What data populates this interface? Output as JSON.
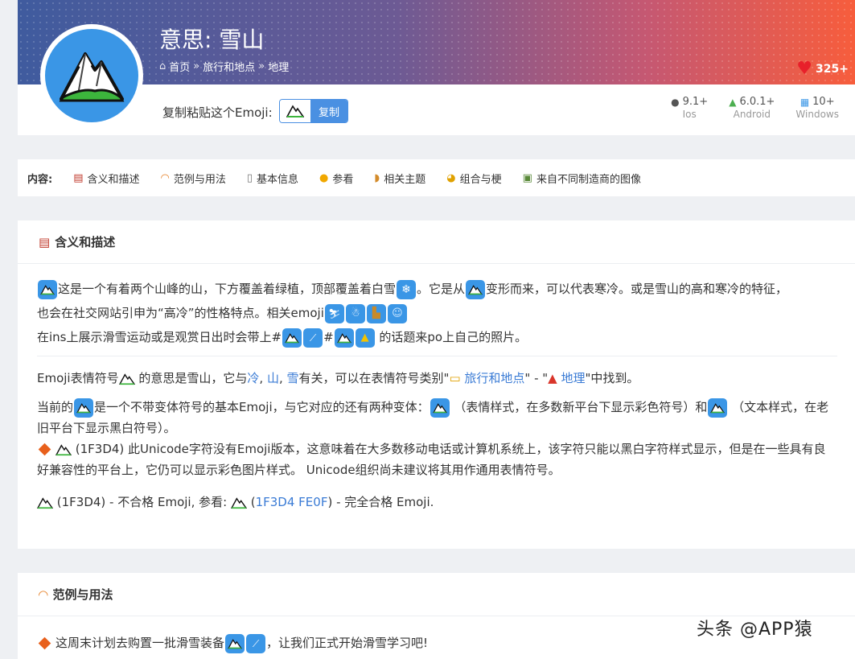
{
  "header": {
    "title": "意思: 雪山",
    "breadcrumb": [
      "首页",
      "旅行和地点",
      "地理"
    ],
    "breadcrumb_sep": "»",
    "likes": "325+",
    "heart_icon": "heart-icon"
  },
  "copy": {
    "label": "复制粘贴这个Emoji:",
    "button": "复制"
  },
  "platforms": [
    {
      "version": "9.1+",
      "name": "Ios",
      "icon": "apple-icon"
    },
    {
      "version": "6.0.1+",
      "name": "Android",
      "icon": "android-icon"
    },
    {
      "version": "10+",
      "name": "Windows",
      "icon": "windows-icon"
    }
  ],
  "toc": {
    "label": "内容:",
    "items": [
      "含义和描述",
      "范例与用法",
      "基本信息",
      "参看",
      "相关主题",
      "组合与梗",
      "来自不同制造商的图像"
    ]
  },
  "section1": {
    "title": "含义和描述",
    "p1_a": "这是一个有着两个山峰的山，下方覆盖着绿植，顶部覆盖着白雪",
    "p1_b": "。它是从",
    "p1_c": "变形而来，可以代表寒冷。或是雪山的高和寒冷的特征，",
    "p1_d": "也会在社交网站引申为“高冷”的性格特点。相关emoji",
    "p1_e": "在ins上展示滑雪运动或是观赏日出时会带上#",
    "p1_f": "#",
    "p1_g": " 的话题来po上自己的照片。",
    "p2_a": "Emoji表情符号",
    "p2_b": " 的意思是雪山，它与",
    "p2_link1": "冷",
    "p2_sep1": ", ",
    "p2_link2": "山",
    "p2_sep2": ", ",
    "p2_link3": "雪",
    "p2_c": "有关，可以在表情符号类别\"",
    "p2_link4": " 旅行和地点",
    "p2_d": "\" - \"",
    "p2_link5": " 地理",
    "p2_e": "\"中找到。",
    "p3_a": "当前的",
    "p3_b": "是一个不带变体符号的基本Emoji，与它对应的还有两种变体：",
    "p3_c": " （表情样式，在多数新平台下显示彩色符号）和",
    "p3_d": " （文本样式，在老旧平台下显示黑白符号）。",
    "p4": " (1F3D4) 此Unicode字符没有Emoji版本，这意味着在大多数移动电话或计算机系统上，该字符只能以黑白字符样式显示，但是在一些具有良好兼容性的平台上，它仍可以显示彩色图片样式。 Unicode组织尚未建议将其用作通用表情符号。",
    "p5_a": " (1F3D4) - 不合格 Emoji, 参看: ",
    "p5_b": " (",
    "p5_link": "1F3D4 FE0F",
    "p5_c": ") - 完全合格 Emoji."
  },
  "section2": {
    "title": "范例与用法",
    "ex1_a": "这周末计划去购置一批滑雪装备",
    "ex1_b": "，让我们正式开始滑雪学习吧!"
  },
  "watermark": "头条 @APP猿",
  "colors": {
    "accent": "#3a96e6",
    "link": "#3a7bd5",
    "diamond": "#e8601c"
  }
}
